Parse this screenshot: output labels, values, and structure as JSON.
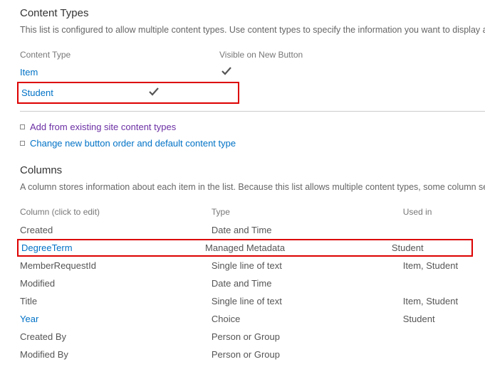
{
  "contentTypes": {
    "title": "Content Types",
    "desc": "This list is configured to allow multiple content types. Use content types to specify the information you want to display about an item. The following content types are currently available in this list:",
    "header_type": "Content Type",
    "header_visible": "Visible on New Button",
    "rows": [
      {
        "name": "Item",
        "visible": true
      },
      {
        "name": "Student",
        "visible": true
      }
    ]
  },
  "actions": {
    "add": "Add from existing site content types",
    "change": "Change new button order and default content type"
  },
  "columns": {
    "title": "Columns",
    "desc": "A column stores information about each item in the list. Because this list allows multiple content types, some column settings, such as required, are set on the content type of the item. The following columns are currently available in this list:",
    "header_col": "Column (click to edit)",
    "header_type": "Type",
    "header_used": "Used in",
    "rows": [
      {
        "name": "Created",
        "type": "Date and Time",
        "used": ""
      },
      {
        "name": "DegreeTerm",
        "type": "Managed Metadata",
        "used": "Student"
      },
      {
        "name": "MemberRequestId",
        "type": "Single line of text",
        "used": "Item, Student"
      },
      {
        "name": "Modified",
        "type": "Date and Time",
        "used": ""
      },
      {
        "name": "Title",
        "type": "Single line of text",
        "used": "Item, Student"
      },
      {
        "name": "Year",
        "type": "Choice",
        "used": "Student"
      },
      {
        "name": "Created By",
        "type": "Person or Group",
        "used": ""
      },
      {
        "name": "Modified By",
        "type": "Person or Group",
        "used": ""
      }
    ]
  }
}
